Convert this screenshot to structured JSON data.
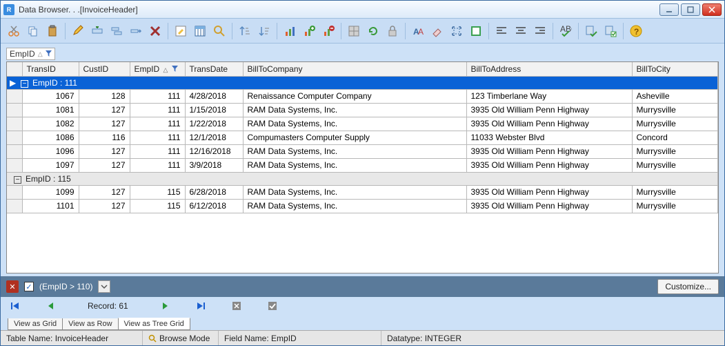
{
  "window": {
    "title": "Data Browser. . .[InvoiceHeader]"
  },
  "group_chip": {
    "label": "EmpID",
    "sort_glyph": "△"
  },
  "columns": {
    "transid": "TransID",
    "custid": "CustID",
    "empid": "EmpID",
    "empid_sort": "△",
    "transdate": "TransDate",
    "billtocompany": "BillToCompany",
    "billtoaddress": "BillToAddress",
    "billtocity": "BillToCity"
  },
  "groups": [
    {
      "label": "EmpID : 111",
      "selected": true,
      "rows": [
        {
          "TransID": "1067",
          "CustID": "128",
          "EmpID": "111",
          "TransDate": "4/28/2018",
          "BillToCompany": "Renaissance Computer Company",
          "BillToAddress": "123 Timberlane Way",
          "BillToCity": "Asheville"
        },
        {
          "TransID": "1081",
          "CustID": "127",
          "EmpID": "111",
          "TransDate": "1/15/2018",
          "BillToCompany": "RAM Data Systems, Inc.",
          "BillToAddress": "3935 Old William Penn Highway",
          "BillToCity": "Murrysville"
        },
        {
          "TransID": "1082",
          "CustID": "127",
          "EmpID": "111",
          "TransDate": "1/22/2018",
          "BillToCompany": "RAM Data Systems, Inc.",
          "BillToAddress": "3935 Old William Penn Highway",
          "BillToCity": "Murrysville"
        },
        {
          "TransID": "1086",
          "CustID": "116",
          "EmpID": "111",
          "TransDate": "12/1/2018",
          "BillToCompany": "Compumasters Computer Supply",
          "BillToAddress": "11033 Webster Blvd",
          "BillToCity": "Concord"
        },
        {
          "TransID": "1096",
          "CustID": "127",
          "EmpID": "111",
          "TransDate": "12/16/2018",
          "BillToCompany": "RAM Data Systems, Inc.",
          "BillToAddress": "3935 Old William Penn Highway",
          "BillToCity": "Murrysville"
        },
        {
          "TransID": "1097",
          "CustID": "127",
          "EmpID": "111",
          "TransDate": "3/9/2018",
          "BillToCompany": "RAM Data Systems, Inc.",
          "BillToAddress": "3935 Old William Penn Highway",
          "BillToCity": "Murrysville"
        }
      ]
    },
    {
      "label": "EmpID : 115",
      "selected": false,
      "rows": [
        {
          "TransID": "1099",
          "CustID": "127",
          "EmpID": "115",
          "TransDate": "6/28/2018",
          "BillToCompany": "RAM Data Systems, Inc.",
          "BillToAddress": "3935 Old William Penn Highway",
          "BillToCity": "Murrysville"
        },
        {
          "TransID": "1101",
          "CustID": "127",
          "EmpID": "115",
          "TransDate": "6/12/2018",
          "BillToCompany": "RAM Data Systems, Inc.",
          "BillToAddress": "3935 Old William Penn Highway",
          "BillToCity": "Murrysville"
        }
      ]
    }
  ],
  "filter": {
    "expression": "(EmpID > 110)",
    "customize": "Customize..."
  },
  "nav": {
    "record_label": "Record: 61"
  },
  "view_tabs": {
    "grid": "View as Grid",
    "row": "View as Row",
    "tree": "View as Tree Grid"
  },
  "status": {
    "table_label": "Table Name: InvoiceHeader",
    "mode": "Browse Mode",
    "field_label": "Field Name: EmpID",
    "datatype": "Datatype: INTEGER"
  }
}
